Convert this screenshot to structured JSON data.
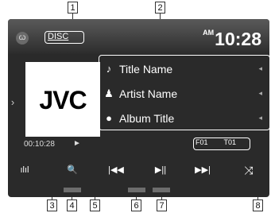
{
  "callouts": {
    "c1": "1",
    "c2": "2",
    "c3": "3",
    "c4": "4",
    "c5": "5",
    "c6": "6",
    "c7": "7",
    "c8": "8"
  },
  "header": {
    "source_label": "DISC",
    "ampm": "AM",
    "time": "10:28"
  },
  "album_art": {
    "logo_text": "JVC"
  },
  "track_info": [
    {
      "icon": "music-note-icon",
      "glyph": "♪",
      "label": "Title Name"
    },
    {
      "icon": "artist-icon",
      "glyph": "♟",
      "label": "Artist Name"
    },
    {
      "icon": "album-icon",
      "glyph": "●",
      "label": "Album Title"
    }
  ],
  "playback": {
    "elapsed": "00:10:28",
    "state_glyph": "►",
    "folder": "F01",
    "track": "T01"
  },
  "controls": {
    "equalizer_glyph": "ılıl",
    "search_glyph": "🔍",
    "prev_glyph": "|◀◀",
    "play_pause_glyph": "▶||",
    "next_glyph": "▶▶|",
    "shuffle_glyph": "⤨"
  }
}
